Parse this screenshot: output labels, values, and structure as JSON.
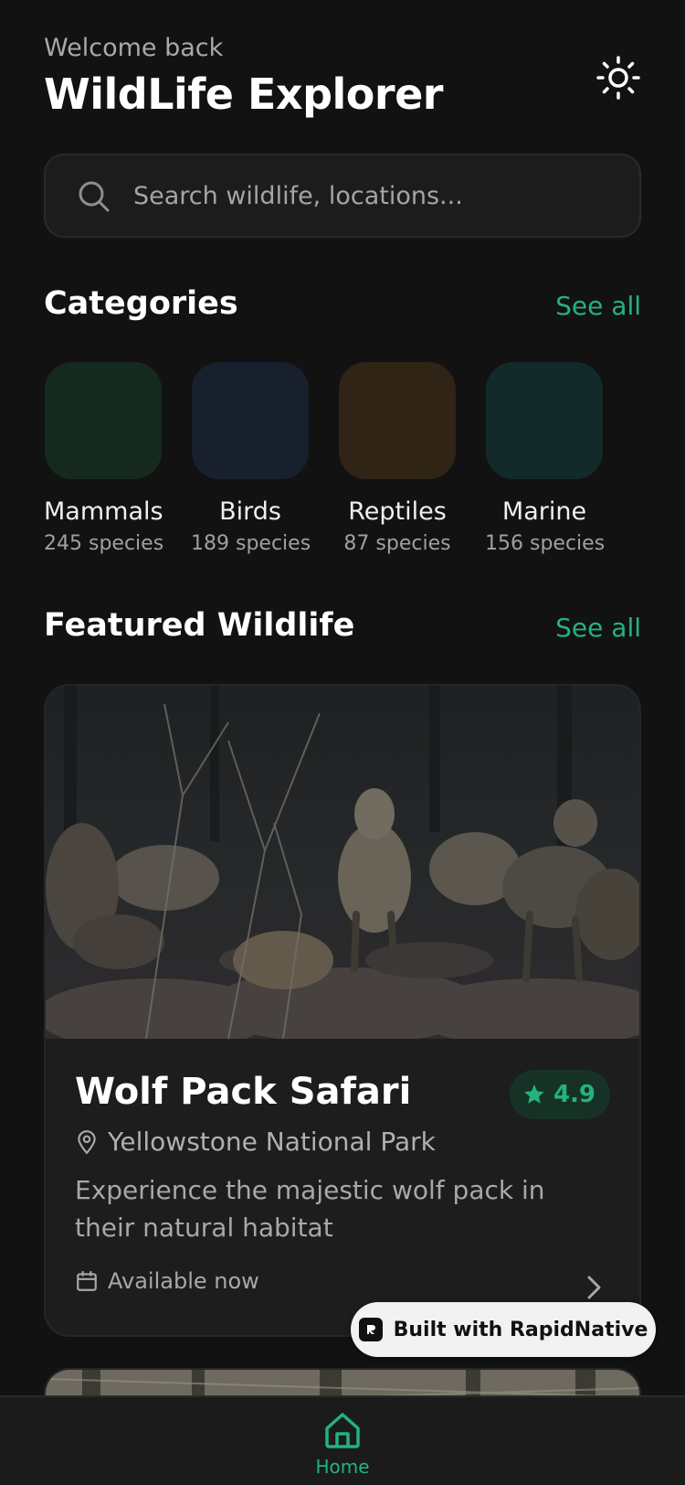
{
  "header": {
    "welcome": "Welcome back",
    "title": "WildLife Explorer",
    "theme_icon": "sun-icon"
  },
  "search": {
    "placeholder": "Search wildlife, locations..."
  },
  "categories": {
    "title": "Categories",
    "see_all": "See all",
    "items": [
      {
        "name": "Mammals",
        "count": "245 species",
        "color": "#16291f"
      },
      {
        "name": "Birds",
        "count": "189 species",
        "color": "#18202e"
      },
      {
        "name": "Reptiles",
        "count": "87 species",
        "color": "#2f2415"
      },
      {
        "name": "Marine",
        "count": "156 species",
        "color": "#132a2a"
      }
    ]
  },
  "featured": {
    "title": "Featured Wildlife",
    "see_all": "See all",
    "card": {
      "title": "Wolf Pack Safari",
      "rating": "4.9",
      "location": "Yellowstone National Park",
      "description": "Experience the majestic wolf pack in their natural habitat",
      "availability": "Available now"
    }
  },
  "badge": {
    "text": "Built with RapidNative"
  },
  "tabbar": {
    "home_label": "Home"
  },
  "colors": {
    "accent": "#22b37f",
    "background": "#121212",
    "card": "#1d1d1e"
  }
}
